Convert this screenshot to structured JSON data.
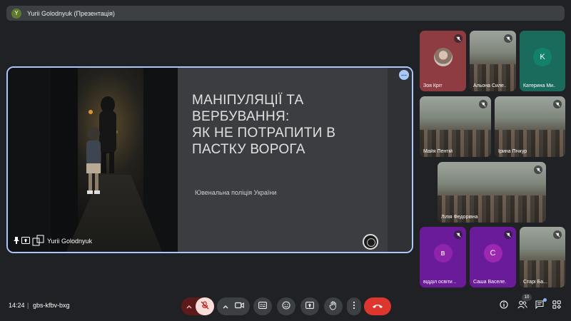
{
  "top_bar": {
    "avatar_letter": "Y",
    "title": "Yurii Golodnyuk (Презентація)"
  },
  "presentation": {
    "slide_title": "МАНІПУЛЯЦІЇ ТА\nВЕРБУВАННЯ:\nЯК НЕ ПОТРАПИТИ В\nПАСТКУ ВОРОГА",
    "slide_subtitle": "Ювенальна поліція України",
    "presenter_name": "Yurii Golodnyuk",
    "more_glyph": "⋯"
  },
  "participants": [
    {
      "name": "Зоя Кріт",
      "type": "photo-avatar",
      "tile_color": "#8e3b42",
      "muted": true
    },
    {
      "name": "Альона Силе...",
      "type": "video",
      "muted": true
    },
    {
      "name": "Катерина Ми...",
      "type": "letter",
      "letter": "K",
      "tile_color": "#1a6b5c",
      "avatar_color": "#12816b",
      "muted": false
    },
    {
      "name": "Майя Пентій",
      "type": "video",
      "muted": true
    },
    {
      "name": "Ірина Пічкур",
      "type": "video",
      "muted": true
    },
    {
      "name": "Лілія Федорівна",
      "type": "video",
      "muted": true
    },
    {
      "name": "відділ освіти ...",
      "type": "letter",
      "letter": "в",
      "tile_color": "#6a1b9a",
      "avatar_color": "#8e24aa",
      "muted": true
    },
    {
      "name": "Саша Васеле...",
      "type": "letter",
      "letter": "С",
      "tile_color": "#6a1b9a",
      "avatar_color": "#9c27b0",
      "muted": true
    },
    {
      "name": "Старі Ба...",
      "type": "video",
      "muted": true
    }
  ],
  "bottom_bar": {
    "time": "14:24",
    "separator": "|",
    "meeting_code": "gbs-kfbv-bxg",
    "participant_count": "10"
  },
  "icons": {
    "mic_off": "mic-off-icon",
    "camera": "camera-icon",
    "captions": "captions-icon",
    "emoji": "emoji-icon",
    "present": "present-icon",
    "raise_hand": "raise-hand-icon",
    "more": "more-vert-icon",
    "end_call": "end-call-icon",
    "info": "info-icon",
    "people": "people-icon",
    "chat": "chat-icon",
    "activities": "activities-icon"
  },
  "colors": {
    "accent_blue": "#a8c7fa",
    "end_call_red": "#dc362e",
    "mic_off_bg": "#f9dedc"
  }
}
